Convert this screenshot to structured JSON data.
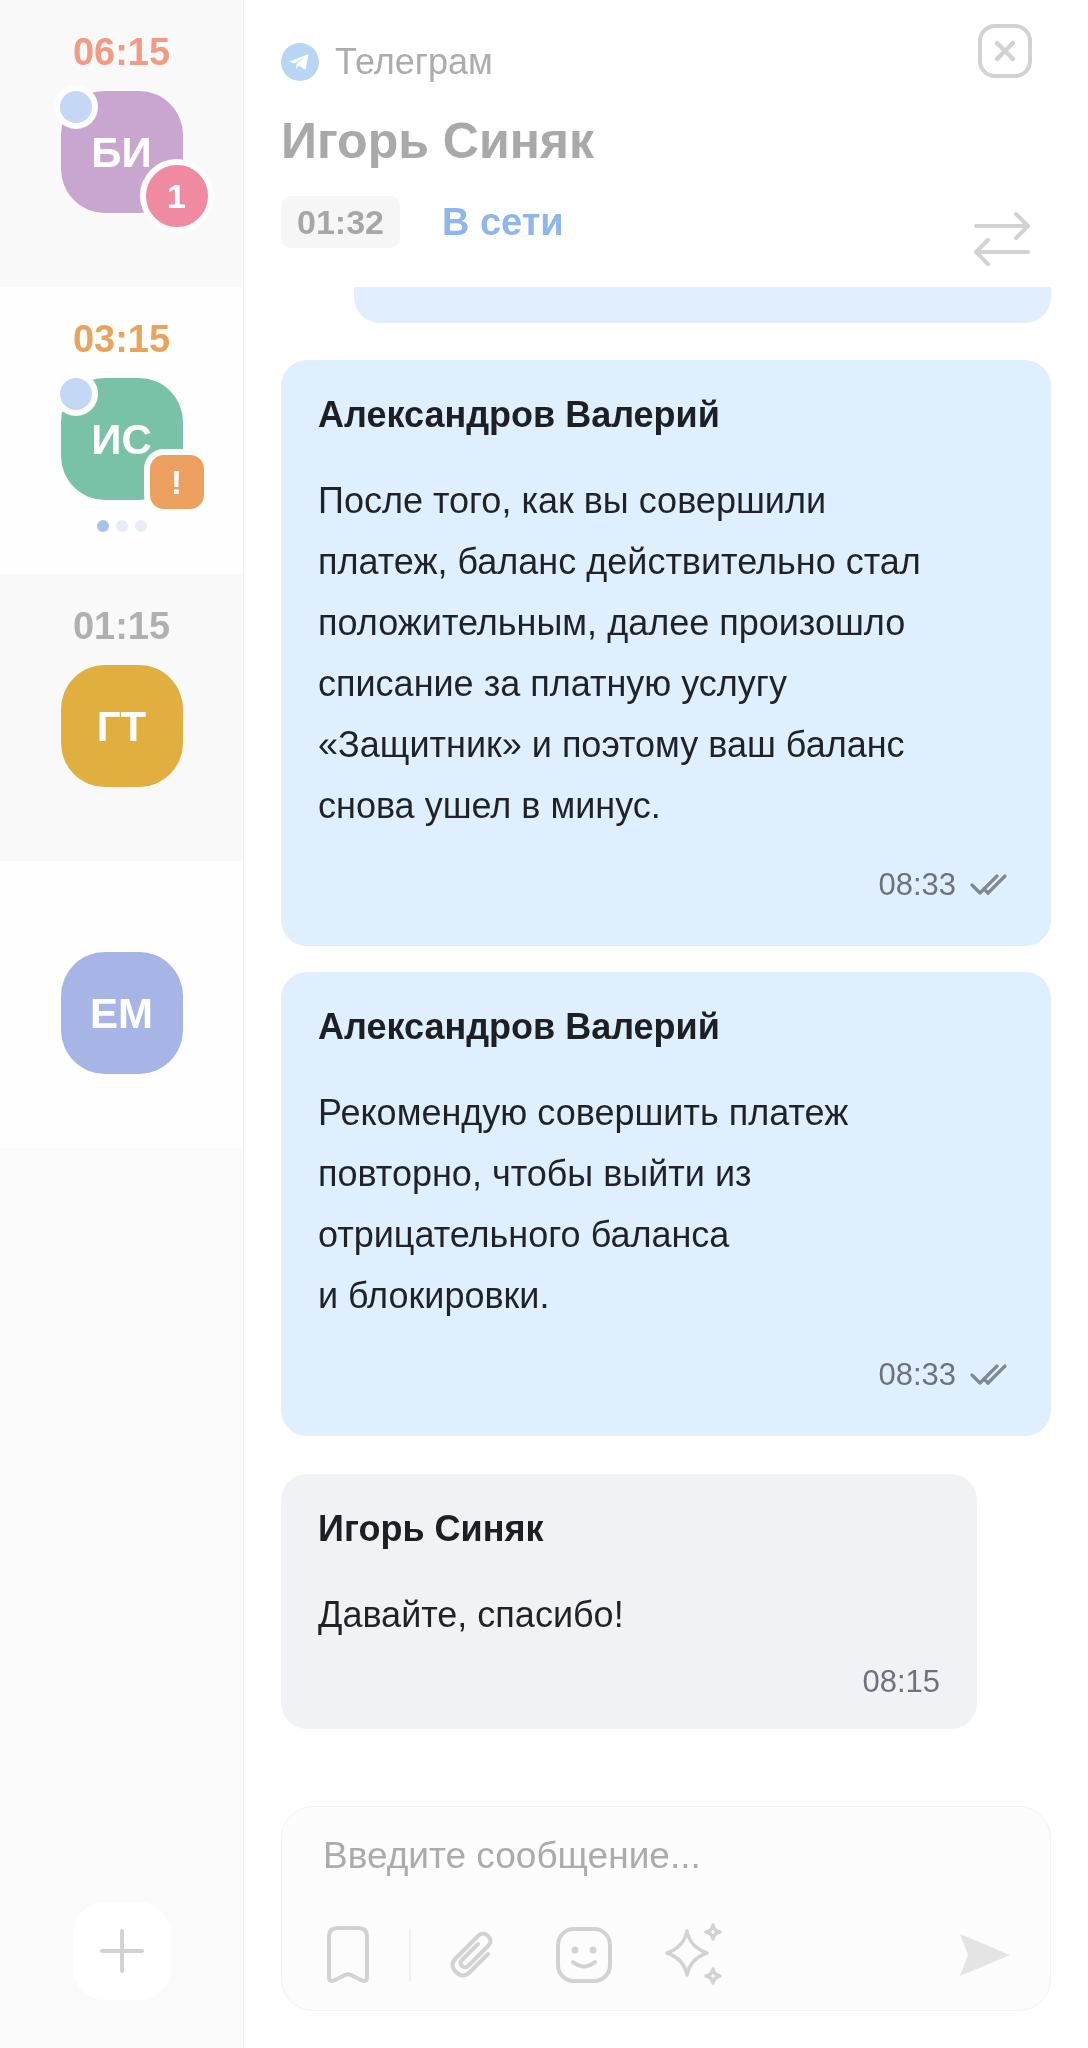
{
  "sidebar": {
    "chats": [
      {
        "time": {
          "text": "06:15",
          "color": "#f29a84"
        },
        "avatar": {
          "initials": "БИ",
          "color": "#c9a6cf"
        },
        "online": true,
        "badge": {
          "kind": "count",
          "text": "1"
        }
      },
      {
        "time": {
          "text": "03:15",
          "color": "#e8a45a"
        },
        "avatar": {
          "initials": "ИС",
          "color": "#79c2a7"
        },
        "online": true,
        "badge": {
          "kind": "alert",
          "text": "!"
        },
        "pages": [
          {
            "selected": true
          },
          {
            "selected": false
          },
          {
            "selected": false
          }
        ]
      },
      {
        "time": {
          "text": "01:15",
          "color": "#b0b0b0"
        },
        "avatar": {
          "initials": "ГТ",
          "color": "#e0af40"
        },
        "online": false
      },
      {
        "avatar": {
          "initials": "ЕМ",
          "color": "#a7b4e6"
        },
        "online": false
      }
    ]
  },
  "header": {
    "channel": "Телеграм",
    "title": "Игорь Синяк",
    "timer": "01:32",
    "status": "В сети"
  },
  "thread": {
    "clipped_bubble": true,
    "messages": [
      {
        "sender": "Александров Валерий",
        "text": "После того, как вы совершили\nплатеж, баланс действительно стал\nположительным, далее произошло\nсписание за платную услугу\n«Защитник» и поэтому ваш баланс\nснова ушел в минус.",
        "time": "08:33",
        "outgoing": true,
        "read": true
      },
      {
        "sender": "Александров Валерий",
        "text": "Рекомендую совершить платеж\nповторно, чтобы выйти из\nотрицательного баланса\nи блокировки.",
        "time": "08:33",
        "outgoing": true,
        "read": true
      },
      {
        "sender": "Игорь Синяк",
        "text": "Давайте, спасибо!",
        "time": "08:15",
        "outgoing": false
      }
    ]
  },
  "composer": {
    "placeholder": "Введите сообщение..."
  }
}
